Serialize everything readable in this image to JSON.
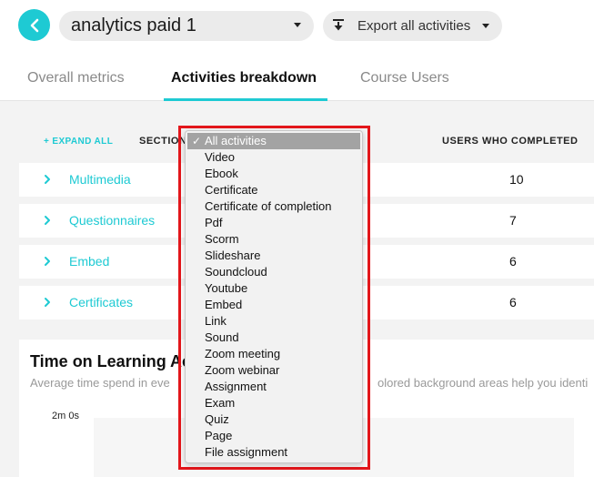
{
  "header": {
    "course_name": "analytics paid 1",
    "export_label": "Export all activities"
  },
  "tabs": [
    {
      "label": "Overall metrics",
      "active": false
    },
    {
      "label": "Activities breakdown",
      "active": true
    },
    {
      "label": "Course Users",
      "active": false
    }
  ],
  "table": {
    "expand_all": "+ EXPAND ALL",
    "col_section": "SECTION",
    "col_completed": "USERS WHO COMPLETED",
    "rows": [
      {
        "name": "Multimedia",
        "completed": "10"
      },
      {
        "name": "Questionnaires",
        "completed": "7"
      },
      {
        "name": "Embed",
        "completed": "6"
      },
      {
        "name": "Certificates",
        "completed": "6"
      }
    ]
  },
  "time_card": {
    "title": "Time on Learning Ac",
    "subtitle": "Average time spend in eve",
    "subtitle_right": "olored background areas help you identi",
    "y_top_label": "2m 0s"
  },
  "activity_filter": {
    "selected": "All activities",
    "options": [
      "All activities",
      "Video",
      "Ebook",
      "Certificate",
      "Certificate of completion",
      "Pdf",
      "Scorm",
      "Slideshare",
      "Soundcloud",
      "Youtube",
      "Embed",
      "Link",
      "Sound",
      "Zoom meeting",
      "Zoom webinar",
      "Assignment",
      "Exam",
      "Quiz",
      "Page",
      "File assignment"
    ]
  },
  "colors": {
    "accent": "#1ecad3",
    "highlight_border": "#e3161b"
  }
}
